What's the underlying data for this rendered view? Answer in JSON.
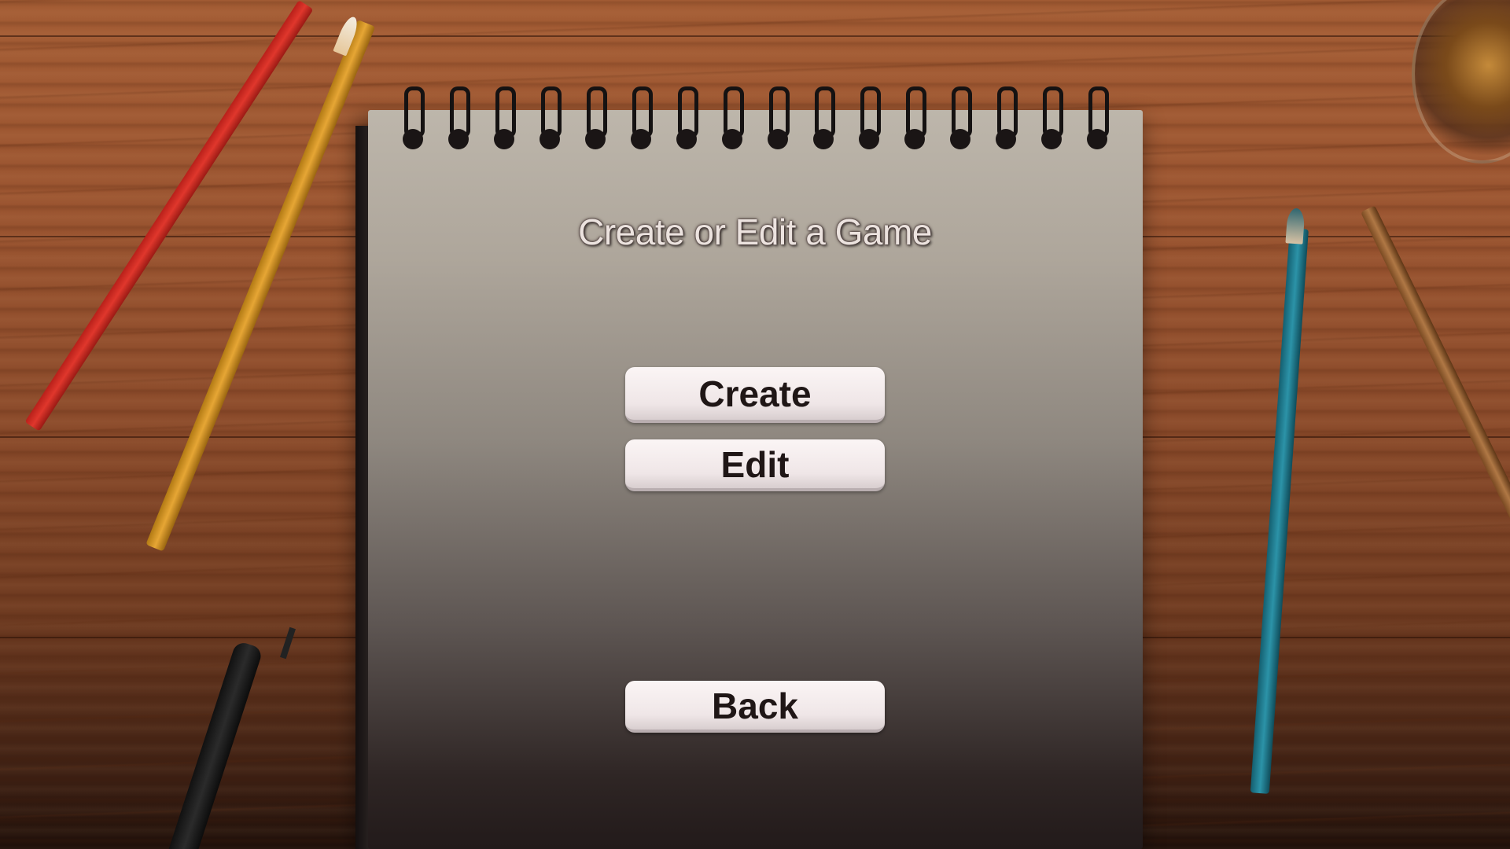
{
  "menu": {
    "title": "Create or Edit a Game",
    "buttons": {
      "create": "Create",
      "edit": "Edit",
      "back": "Back"
    }
  },
  "icons": [
    "spiral-binding-icon"
  ],
  "colors": {
    "button_background": "#f2eaea",
    "button_text": "#1f1616",
    "title_text": "#ece3df",
    "desk_wood": "#9a5430",
    "paper": "#b2aba0"
  }
}
